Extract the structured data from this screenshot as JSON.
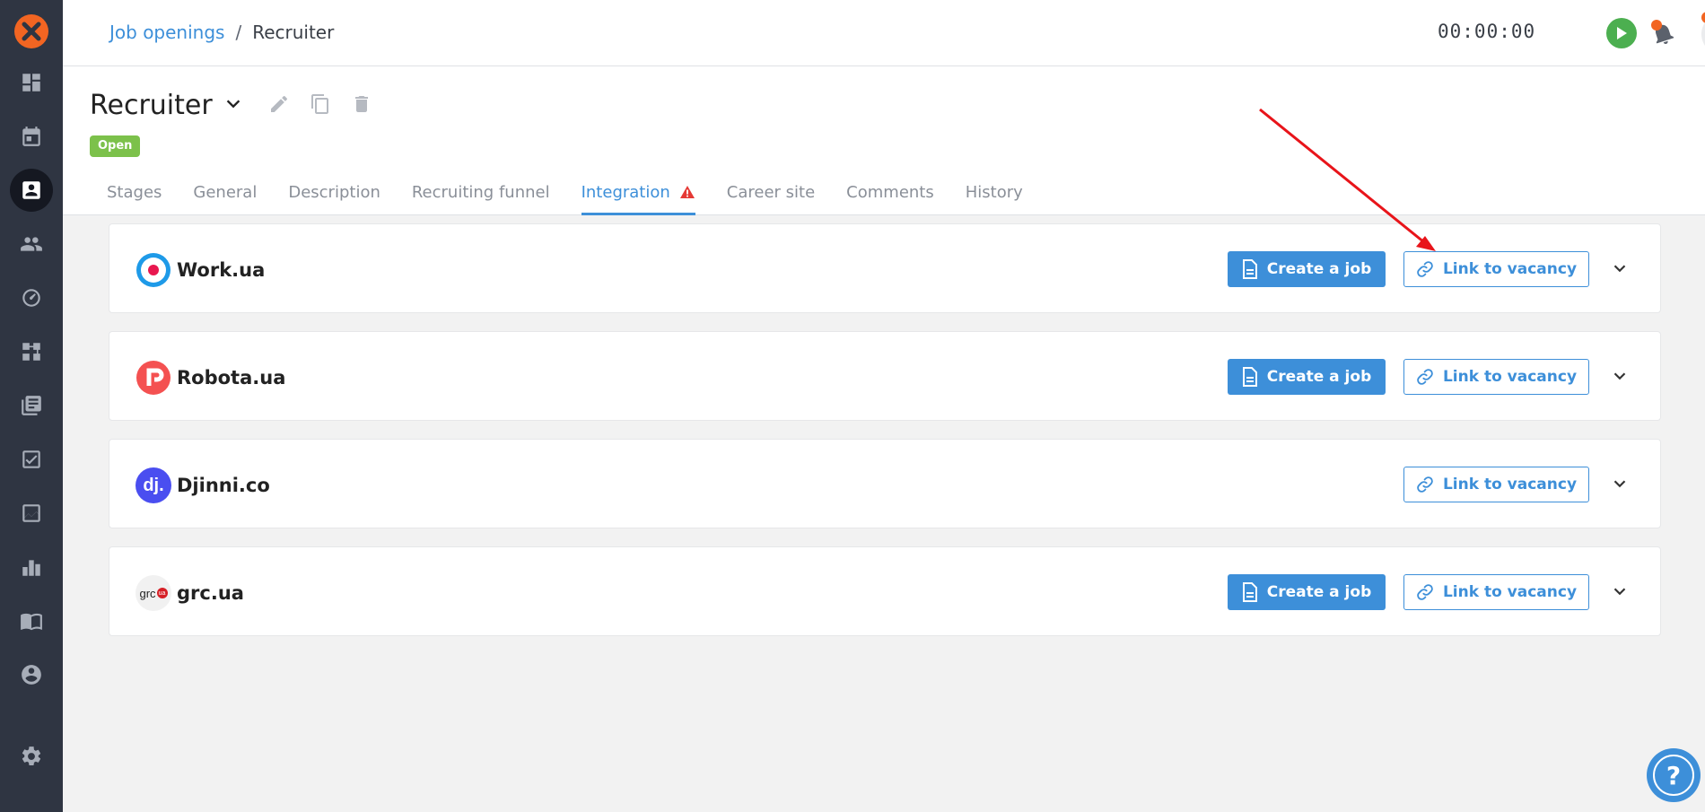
{
  "breadcrumb": {
    "parent": "Job openings",
    "separator": "/",
    "current": "Recruiter"
  },
  "timer": {
    "value": "00:00:00"
  },
  "job": {
    "title": "Recruiter",
    "status": "Open"
  },
  "tabs": [
    {
      "label": "Stages"
    },
    {
      "label": "General"
    },
    {
      "label": "Description"
    },
    {
      "label": "Recruiting funnel"
    },
    {
      "label": "Integration"
    },
    {
      "label": "Career site"
    },
    {
      "label": "Comments"
    },
    {
      "label": "History"
    }
  ],
  "active_tab": "Integration",
  "integrations": [
    {
      "name": "Work.ua",
      "create_label": "Create a job",
      "link_label": "Link to vacancy"
    },
    {
      "name": "Robota.ua",
      "create_label": "Create a job",
      "link_label": "Link to vacancy"
    },
    {
      "name": "Djinni.co",
      "link_label": "Link to vacancy",
      "djinni_logo_text": "dj."
    },
    {
      "name": "grc.ua",
      "create_label": "Create a job",
      "link_label": "Link to vacancy",
      "grc_logo_text": "grc",
      "grc_logo_badge": "ua"
    }
  ],
  "help": {
    "label": "?"
  },
  "colors": {
    "sidebar": "#2f3542",
    "accent": "#3d8fd9",
    "brand": "#f26522",
    "open_badge": "#7cc14b",
    "annotation_arrow": "#e8141a"
  }
}
